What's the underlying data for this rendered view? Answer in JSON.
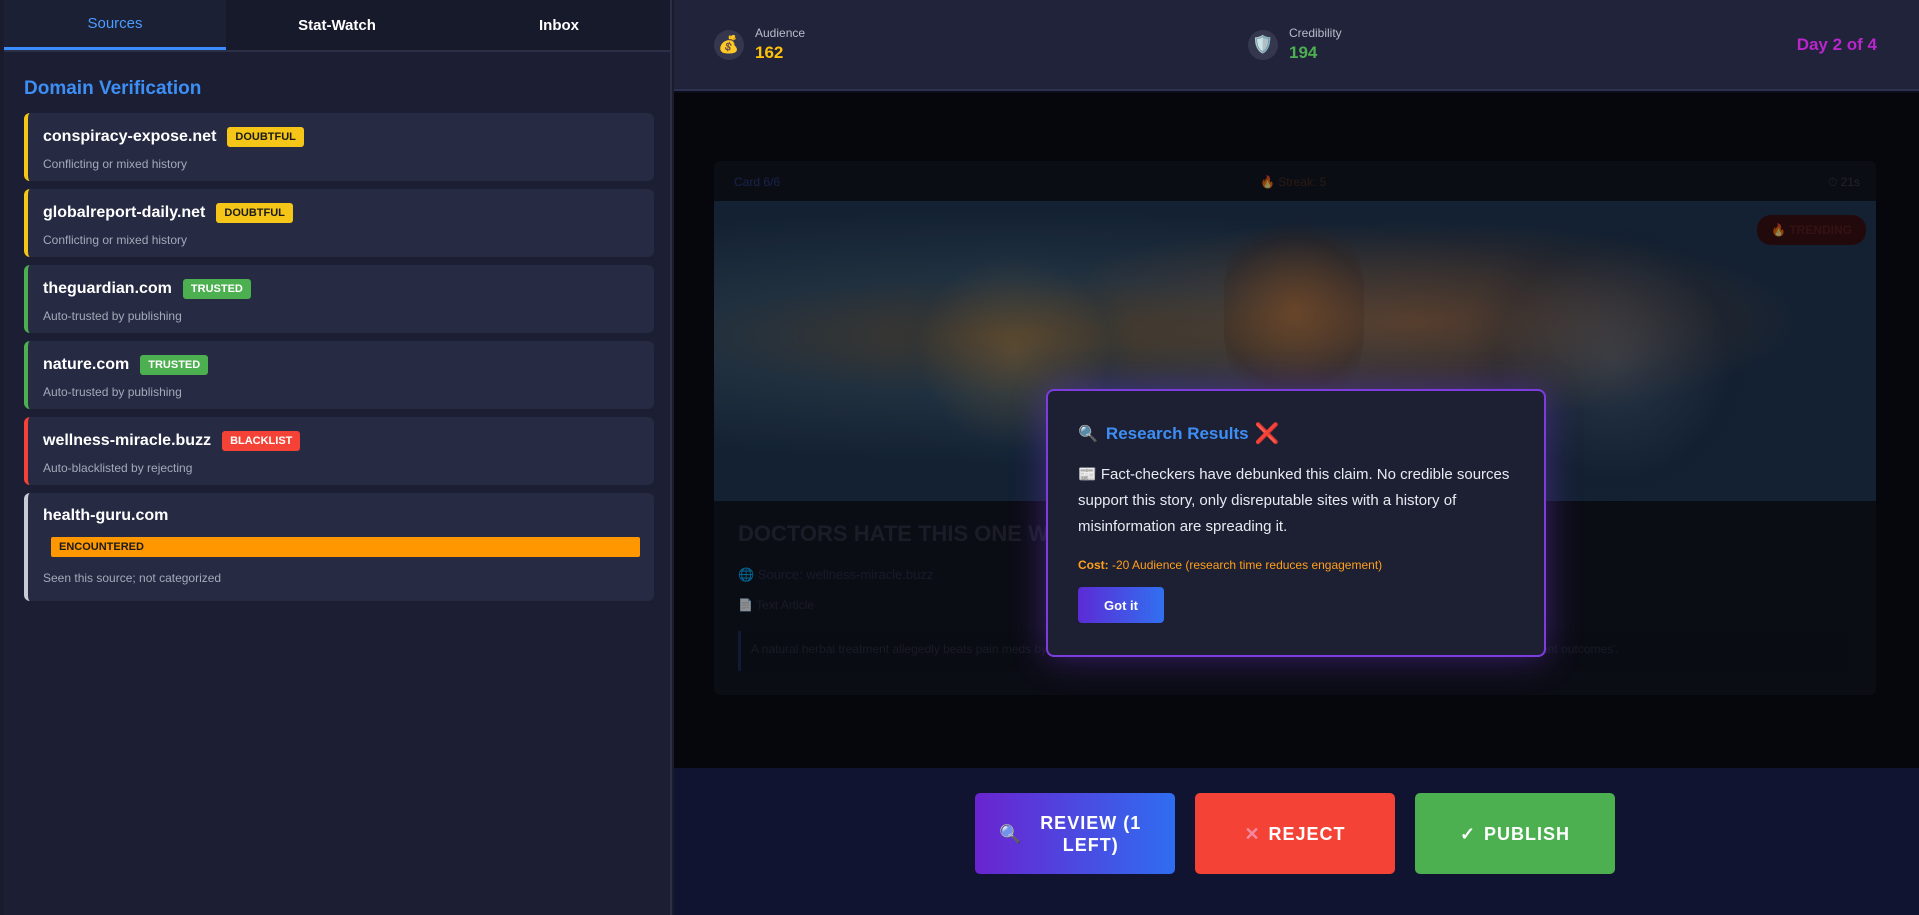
{
  "tabs": [
    "Sources",
    "Stat-Watch",
    "Inbox"
  ],
  "sidebar_title": "Domain Verification",
  "domains": [
    {
      "name": "conspiracy-expose.net",
      "badge": "DOUBTFUL",
      "desc": "Conflicting or mixed history",
      "status": "doubtful"
    },
    {
      "name": "globalreport-daily.net",
      "badge": "DOUBTFUL",
      "desc": "Conflicting or mixed history",
      "status": "doubtful"
    },
    {
      "name": "theguardian.com",
      "badge": "TRUSTED",
      "desc": "Auto-trusted by publishing",
      "status": "trusted"
    },
    {
      "name": "nature.com",
      "badge": "TRUSTED",
      "desc": "Auto-trusted by publishing",
      "status": "trusted"
    },
    {
      "name": "wellness-miracle.buzz",
      "badge": "BLACKLIST",
      "desc": "Auto-blacklisted by rejecting",
      "status": "blacklist"
    },
    {
      "name": "health-guru.com",
      "badge": "ENCOUNTERED",
      "desc": "Seen this source; not categorized",
      "status": "encountered"
    }
  ],
  "stats": {
    "audience_label": "Audience",
    "audience_value": "162",
    "credibility_label": "Credibility",
    "credibility_value": "194",
    "day": "Day 2 of 4"
  },
  "card": {
    "counter": "Card 6/6",
    "streak": "🔥 Streak: 5",
    "timer": "⏱ 21s",
    "trending": "🔥 TRENDING",
    "headline": "DOCTORS HATE THIS ONE WE                                                      NIC!",
    "source": "🌐 Source: wellness-miracle.buzz",
    "kind": "📄 Text Article",
    "summary": "A natural herbal treatment allegedly beats pain meds by 40%, but the article cites no trial registry or peer-reviewed study and leans on anecdotal 'patient outcomes'."
  },
  "modal": {
    "title": "Research Results",
    "body": "📰 Fact-checkers have debunked this claim. No credible sources support this story, only disreputable sites with a history of misinformation are spreading it.",
    "cost_label": "Cost:",
    "cost_text": " -20 Audience (research time reduces engagement)",
    "button": "Got it"
  },
  "actions": {
    "review": "REVIEW (1 LEFT)",
    "reject": "REJECT",
    "publish": "PUBLISH"
  }
}
